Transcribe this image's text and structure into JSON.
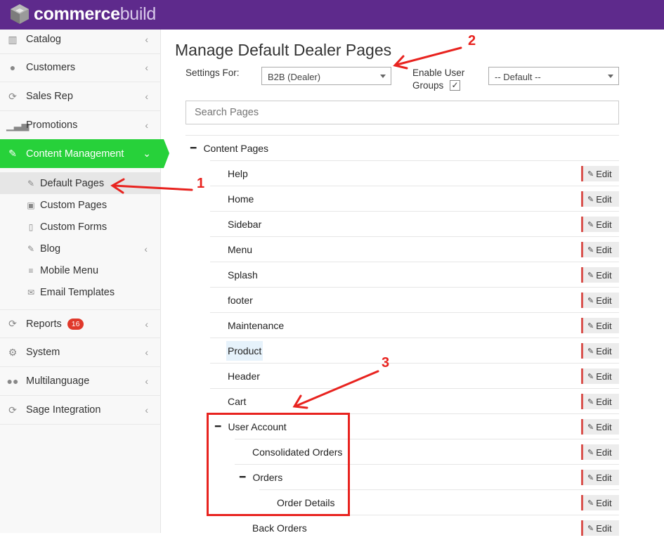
{
  "header": {
    "logo_text_bold": "commerce",
    "logo_text_light": "build",
    "bg_color": "#5e2a8c"
  },
  "sidebar": {
    "items": [
      {
        "label": "Catalog",
        "icon": "barcode-icon"
      },
      {
        "label": "Customers",
        "icon": "user-icon"
      },
      {
        "label": "Sales Rep",
        "icon": "refresh-icon"
      },
      {
        "label": "Promotions",
        "icon": "bar-chart-icon"
      },
      {
        "label": "Content Management",
        "icon": "edit-icon",
        "active": true,
        "color": "#27d13a"
      },
      {
        "label": "Reports",
        "icon": "refresh-icon",
        "badge": "16"
      },
      {
        "label": "System",
        "icon": "cogs-icon"
      },
      {
        "label": "Multilanguage",
        "icon": "users-icon"
      },
      {
        "label": "Sage Integration",
        "icon": "refresh-icon"
      }
    ],
    "subitems": [
      {
        "label": "Default Pages",
        "icon": "pencil-icon",
        "selected": true
      },
      {
        "label": "Custom Pages",
        "icon": "edit-square-icon"
      },
      {
        "label": "Custom Forms",
        "icon": "file-icon"
      },
      {
        "label": "Blog",
        "icon": "pencil-icon"
      },
      {
        "label": "Mobile Menu",
        "icon": "bars-icon"
      },
      {
        "label": "Email Templates",
        "icon": "envelope-icon"
      }
    ]
  },
  "main": {
    "title": "Manage Default Dealer Pages",
    "settings_for_label": "Settings For:",
    "settings_for_value": "B2B (Dealer)",
    "enable_user_groups_line1": "Enable User",
    "enable_user_groups_line2": "Groups",
    "enable_user_groups_checked": true,
    "user_group_value": "-- Default --",
    "search_placeholder": "Search Pages",
    "edit_label": "Edit",
    "tree": [
      {
        "label": "Content Pages",
        "expanded": true
      },
      {
        "label": "Help"
      },
      {
        "label": "Home"
      },
      {
        "label": "Sidebar"
      },
      {
        "label": "Menu"
      },
      {
        "label": "Splash"
      },
      {
        "label": "footer"
      },
      {
        "label": "Maintenance"
      },
      {
        "label": "Product",
        "highlighted": true
      },
      {
        "label": "Header"
      },
      {
        "label": "Cart"
      },
      {
        "label": "User Account",
        "expanded": true
      },
      {
        "label": "Consolidated Orders"
      },
      {
        "label": "Orders",
        "expanded": true
      },
      {
        "label": "Order Details"
      },
      {
        "label": "Back Orders"
      }
    ]
  },
  "annotations": {
    "labels": [
      "1",
      "2",
      "3"
    ],
    "color": "#e8231f"
  }
}
